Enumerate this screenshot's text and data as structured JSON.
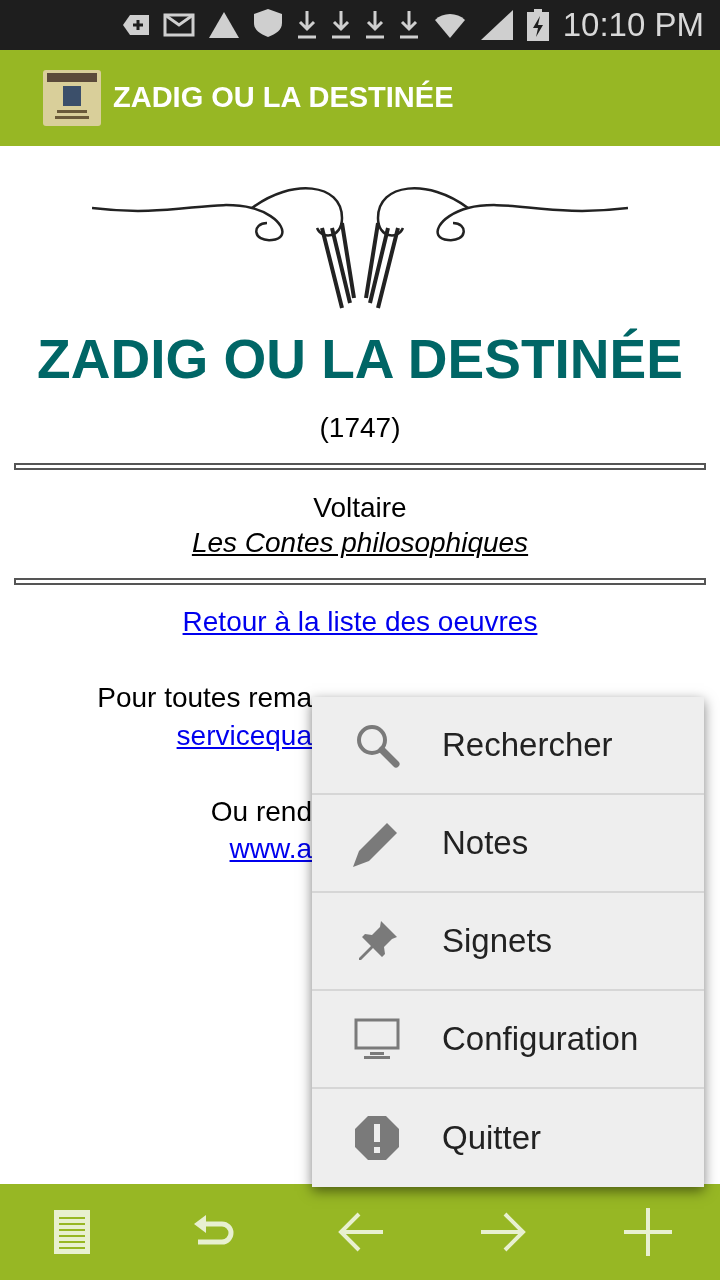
{
  "status_bar": {
    "time": "10:10 PM"
  },
  "app_bar": {
    "title": "ZADIG OU LA DESTINÉE"
  },
  "page": {
    "title": "ZADIG OU LA DESTINÉE",
    "year": "(1747)",
    "author": "Voltaire",
    "collection": "Les Contes philosophiques",
    "back_link": "Retour à la liste des oeuvres",
    "contact_text": "Pour toutes rema",
    "contact_link": "servicequa",
    "site_text": "Ou rend",
    "site_link": "www.a"
  },
  "menu": [
    {
      "kind": "search",
      "label": "Rechercher"
    },
    {
      "kind": "notes",
      "label": "Notes"
    },
    {
      "kind": "bookmarks",
      "label": "Signets"
    },
    {
      "kind": "settings",
      "label": "Configuration"
    },
    {
      "kind": "quit",
      "label": "Quitter"
    }
  ],
  "bottom_bar": [
    {
      "kind": "contents"
    },
    {
      "kind": "back"
    },
    {
      "kind": "previous"
    },
    {
      "kind": "next"
    },
    {
      "kind": "add"
    }
  ]
}
